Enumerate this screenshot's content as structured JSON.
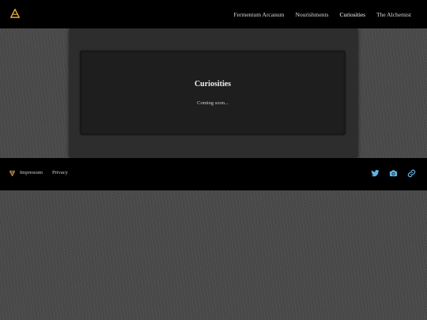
{
  "header": {
    "nav": [
      {
        "label": "Fermentum Arcanum"
      },
      {
        "label": "Nourishments"
      },
      {
        "label": "Curiosities"
      },
      {
        "label": "The Alchemist"
      }
    ]
  },
  "main": {
    "title": "Curiosities",
    "message": "Coming soon..."
  },
  "footer": {
    "links": [
      {
        "label": "Impressum"
      },
      {
        "label": "Privacy"
      }
    ],
    "social": [
      {
        "icon": "twitter-icon"
      },
      {
        "icon": "camera-icon"
      },
      {
        "icon": "link-icon"
      }
    ]
  },
  "colors": {
    "brand": "#e0a93a",
    "social": "#5fb4e8"
  }
}
